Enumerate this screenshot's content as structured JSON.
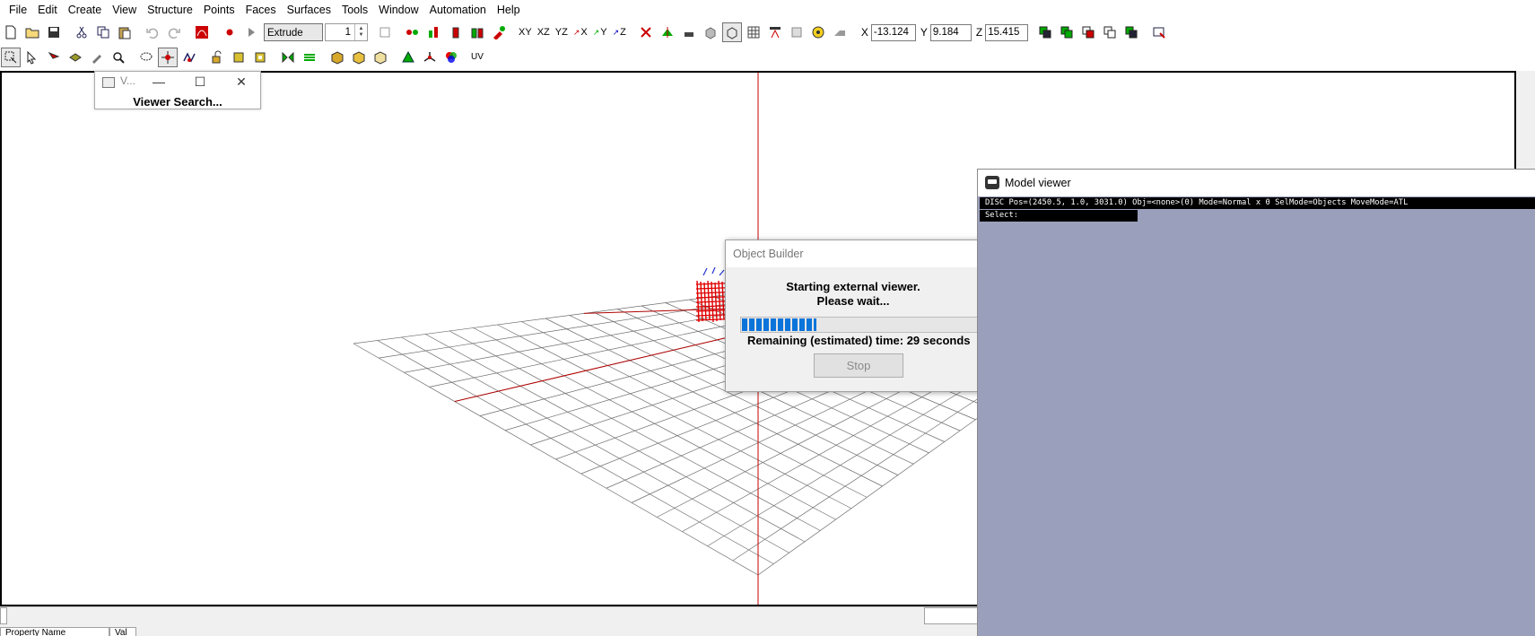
{
  "menu": [
    "File",
    "Edit",
    "Create",
    "View",
    "Structure",
    "Points",
    "Faces",
    "Surfaces",
    "Tools",
    "Window",
    "Automation",
    "Help"
  ],
  "toolbar": {
    "mode": "Extrude",
    "step_value": "1",
    "axis_buttons": [
      "XY",
      "XZ",
      "YZ",
      "X",
      "Y",
      "Z"
    ],
    "coords": {
      "x_label": "X",
      "x": "-13.124",
      "y_label": "Y",
      "y": "9.184",
      "z_label": "Z",
      "z": "15.415"
    },
    "uv_label": "UV"
  },
  "viewer_search": {
    "title_abbr": "V...",
    "body": "Viewer Search...",
    "minimize": "—",
    "maximize": "☐",
    "close": "✕"
  },
  "object_builder": {
    "title": "Object Builder",
    "line1": "Starting external viewer.",
    "line2": "Please wait...",
    "remaining": "Remaining (estimated) time: 29 seconds",
    "stop": "Stop",
    "progress": 0.3
  },
  "model_viewer": {
    "title": "Model viewer",
    "status": "DISC Pos=(2450.5, 1.0, 3031.0) Obj=<none>(0) Mode=Normal x 0 SelMode=Objects MoveMode=ATL",
    "select": "Select:"
  },
  "status_panel": {
    "property_name": "Property Name",
    "value": "Val"
  },
  "colors": {
    "axis": "#c00000",
    "progress": "#0b74da",
    "model_viewer_bg": "#9aa0bc"
  }
}
